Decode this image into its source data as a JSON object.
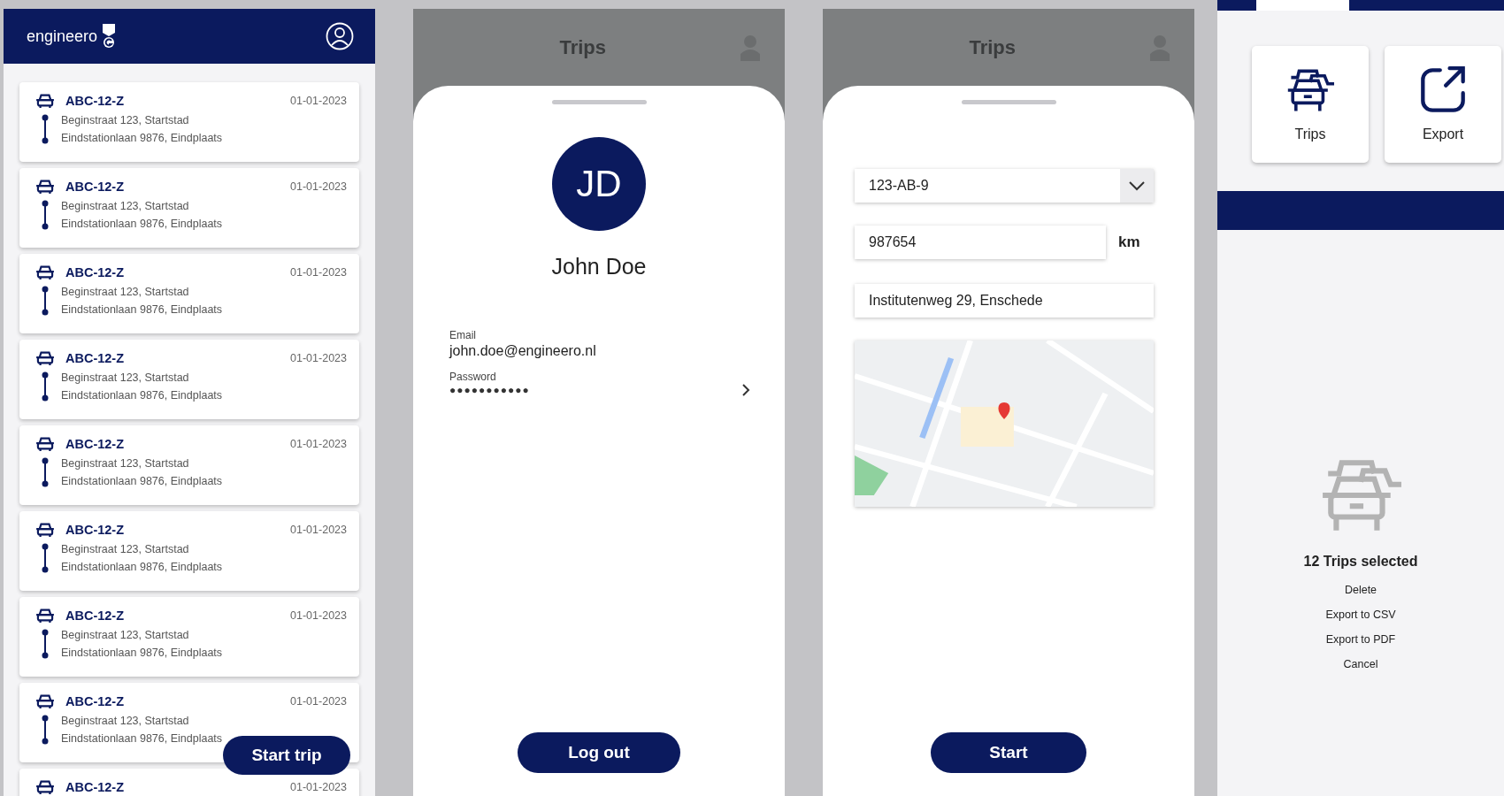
{
  "main": {
    "logo": "engineero",
    "trips": [
      {
        "plate": "ABC-12-Z",
        "date": "01-01-2023",
        "from": "Beginstraat 123, Startstad",
        "to": "Eindstationlaan 9876, Eindplaats"
      },
      {
        "plate": "ABC-12-Z",
        "date": "01-01-2023",
        "from": "Beginstraat 123, Startstad",
        "to": "Eindstationlaan 9876, Eindplaats"
      },
      {
        "plate": "ABC-12-Z",
        "date": "01-01-2023",
        "from": "Beginstraat 123, Startstad",
        "to": "Eindstationlaan 9876, Eindplaats"
      },
      {
        "plate": "ABC-12-Z",
        "date": "01-01-2023",
        "from": "Beginstraat 123, Startstad",
        "to": "Eindstationlaan 9876, Eindplaats"
      },
      {
        "plate": "ABC-12-Z",
        "date": "01-01-2023",
        "from": "Beginstraat 123, Startstad",
        "to": "Eindstationlaan 9876, Eindplaats"
      },
      {
        "plate": "ABC-12-Z",
        "date": "01-01-2023",
        "from": "Beginstraat 123, Startstad",
        "to": "Eindstationlaan 9876, Eindplaats"
      },
      {
        "plate": "ABC-12-Z",
        "date": "01-01-2023",
        "from": "Beginstraat 123, Startstad",
        "to": "Eindstationlaan 9876, Eindplaats"
      },
      {
        "plate": "ABC-12-Z",
        "date": "01-01-2023",
        "from": "Beginstraat 123, Startstad",
        "to": "Eindstationlaan 9876, Eindplaats"
      },
      {
        "plate": "ABC-12-Z",
        "date": "01-01-2023"
      }
    ],
    "start_button": "Start trip"
  },
  "account": {
    "header_title": "Trips",
    "initials": "JD",
    "name": "John Doe",
    "fields": [
      {
        "label": "Email",
        "value": "john.doe@engineero.nl",
        "kind": "text"
      },
      {
        "label": "Password",
        "value": "●●●●●●●●●●●",
        "kind": "password"
      }
    ],
    "logout_button": "Log out"
  },
  "new_trip": {
    "header_title": "Trips",
    "vehicle_select": {
      "value": "123-AB-9"
    },
    "odometer": {
      "value": "987654",
      "unit": "km"
    },
    "address": {
      "value": "Institutenweg 29, Enschede"
    },
    "start_button": "Start"
  },
  "menu": {
    "tiles": [
      {
        "label": "Trips",
        "kind": "trips"
      },
      {
        "label": "Export",
        "kind": "export"
      }
    ],
    "selection": {
      "count_text": "12 Trips selected",
      "actions": [
        "Delete",
        "Export to CSV",
        "Export to PDF",
        "Cancel"
      ]
    }
  }
}
